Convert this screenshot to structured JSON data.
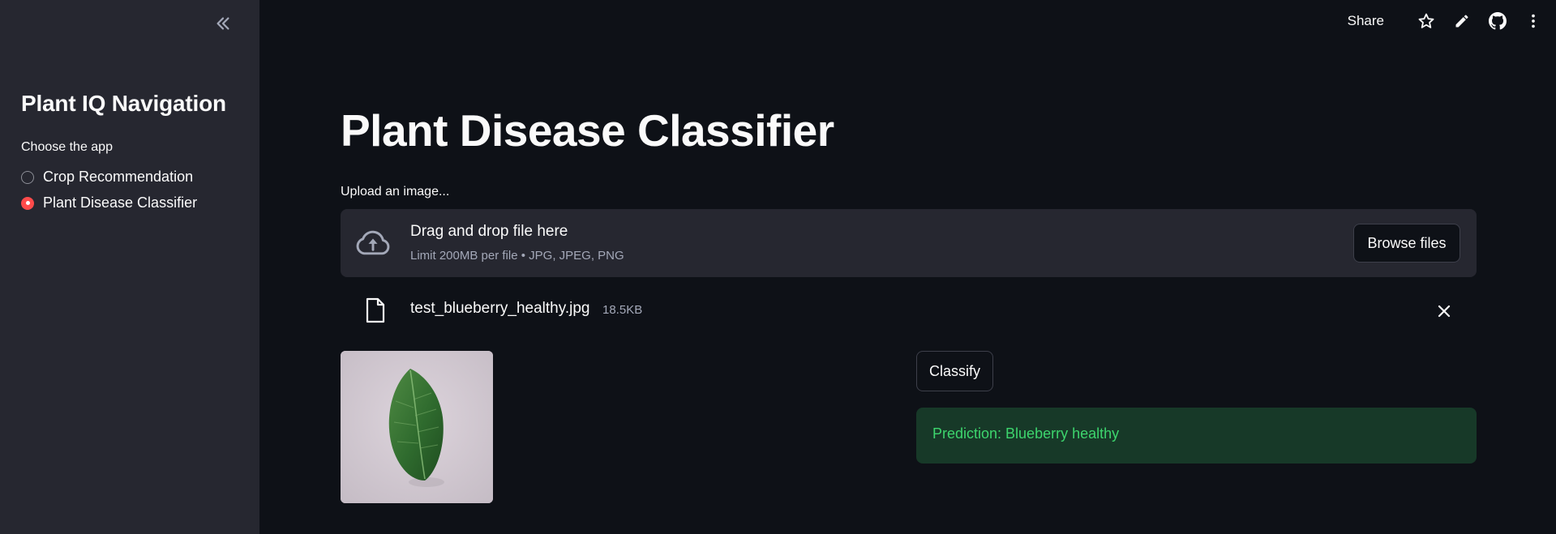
{
  "sidebar": {
    "title": "Plant IQ Navigation",
    "radio_label": "Choose the app",
    "options": [
      {
        "label": "Crop Recommendation",
        "selected": false
      },
      {
        "label": "Plant Disease Classifier",
        "selected": true
      }
    ],
    "collapse_icon": "double-chevron-left-icon"
  },
  "header": {
    "share_label": "Share",
    "icons": [
      "star-icon",
      "edit-icon",
      "github-icon",
      "more-vertical-icon"
    ]
  },
  "main": {
    "title": "Plant Disease Classifier",
    "upload": {
      "label": "Upload an image...",
      "drop_text": "Drag and drop file here",
      "limit_text": "Limit 200MB per file • JPG, JPEG, PNG",
      "browse_label": "Browse files"
    },
    "file": {
      "name": "test_blueberry_healthy.jpg",
      "size": "18.5KB"
    },
    "classify_label": "Classify",
    "prediction_text": "Prediction: Blueberry healthy"
  },
  "colors": {
    "background": "#0e1117",
    "sidebar": "#262730",
    "accent": "#ff4b4b",
    "success_bg": "#173928",
    "success_text": "#3dd56d"
  }
}
